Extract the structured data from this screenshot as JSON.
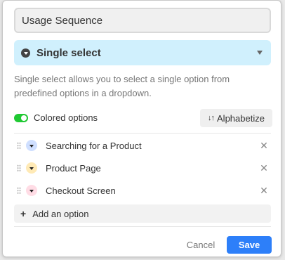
{
  "field": {
    "name_value": "Usage Sequence"
  },
  "type_select": {
    "label": "Single select",
    "icon": "chevron-down-circle-icon"
  },
  "description": "Single select allows you to select a single option from predefined options in a dropdown.",
  "colored_options": {
    "label": "Colored options",
    "enabled": true,
    "color": "#20c933"
  },
  "alphabetize": {
    "label": "Alphabetize",
    "icon": "sort-arrows-icon"
  },
  "options": [
    {
      "label": "Searching for a Product",
      "color": "#cfdfff"
    },
    {
      "label": "Product Page",
      "color": "#ffeab6"
    },
    {
      "label": "Checkout Screen",
      "color": "#ffdce5"
    }
  ],
  "add_option": {
    "label": "Add an option"
  },
  "footer": {
    "cancel_label": "Cancel",
    "save_label": "Save"
  },
  "colors": {
    "accent": "#2d7ff9",
    "type_bg": "#d0f0fd"
  }
}
